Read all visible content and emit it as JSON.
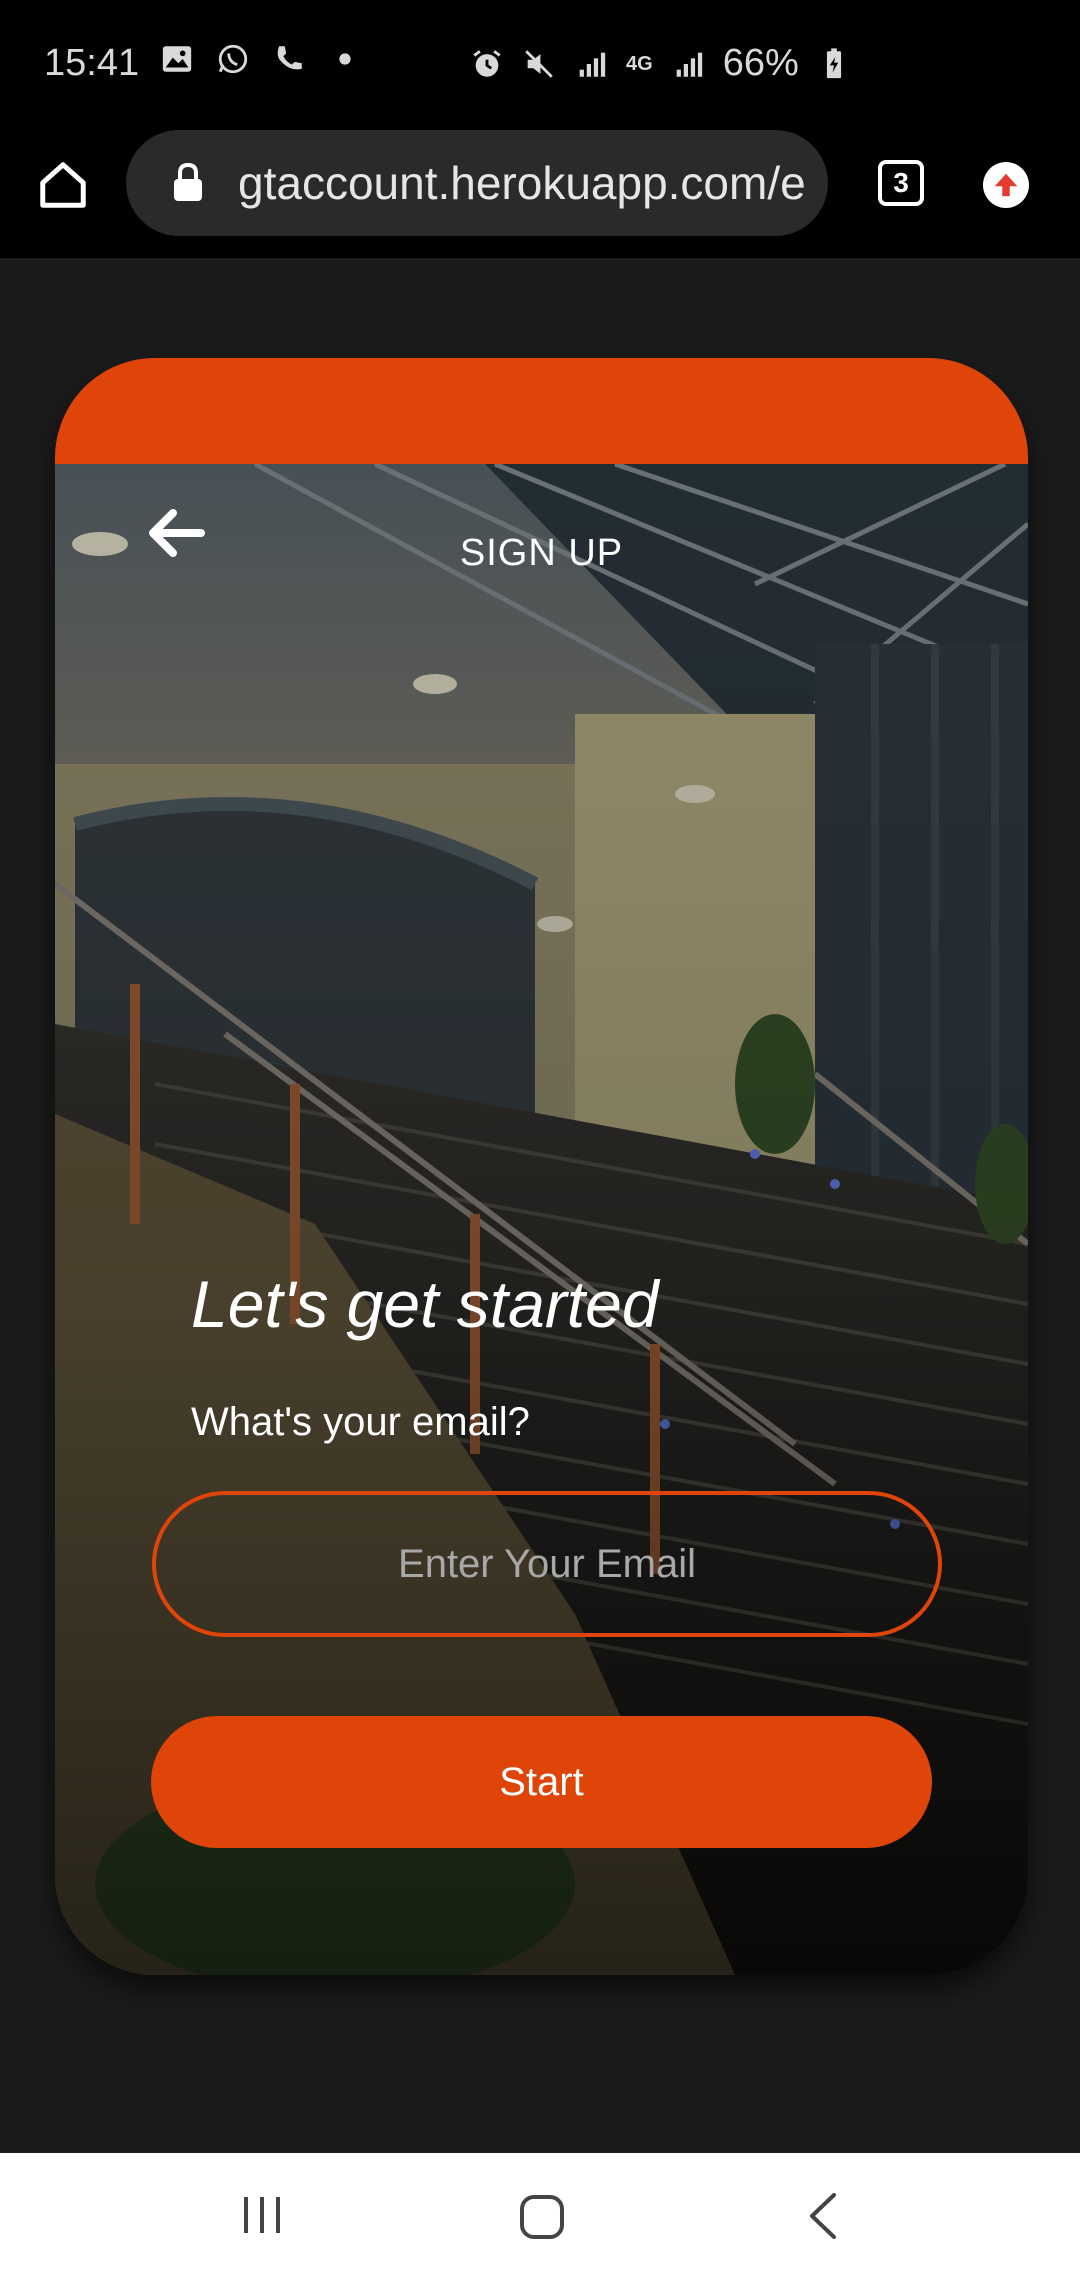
{
  "status_bar": {
    "time": "15:41",
    "battery": "66%",
    "network": "4G"
  },
  "browser": {
    "url": "gtaccount.herokuapp.com/e",
    "tab_count": "3"
  },
  "page": {
    "title": "SIGN UP",
    "headline": "Let's get started",
    "question": "What's your email?",
    "email_placeholder": "Enter Your Email",
    "start_label": "Start"
  },
  "colors": {
    "accent": "#df4409",
    "background": "#1b1b1b"
  }
}
